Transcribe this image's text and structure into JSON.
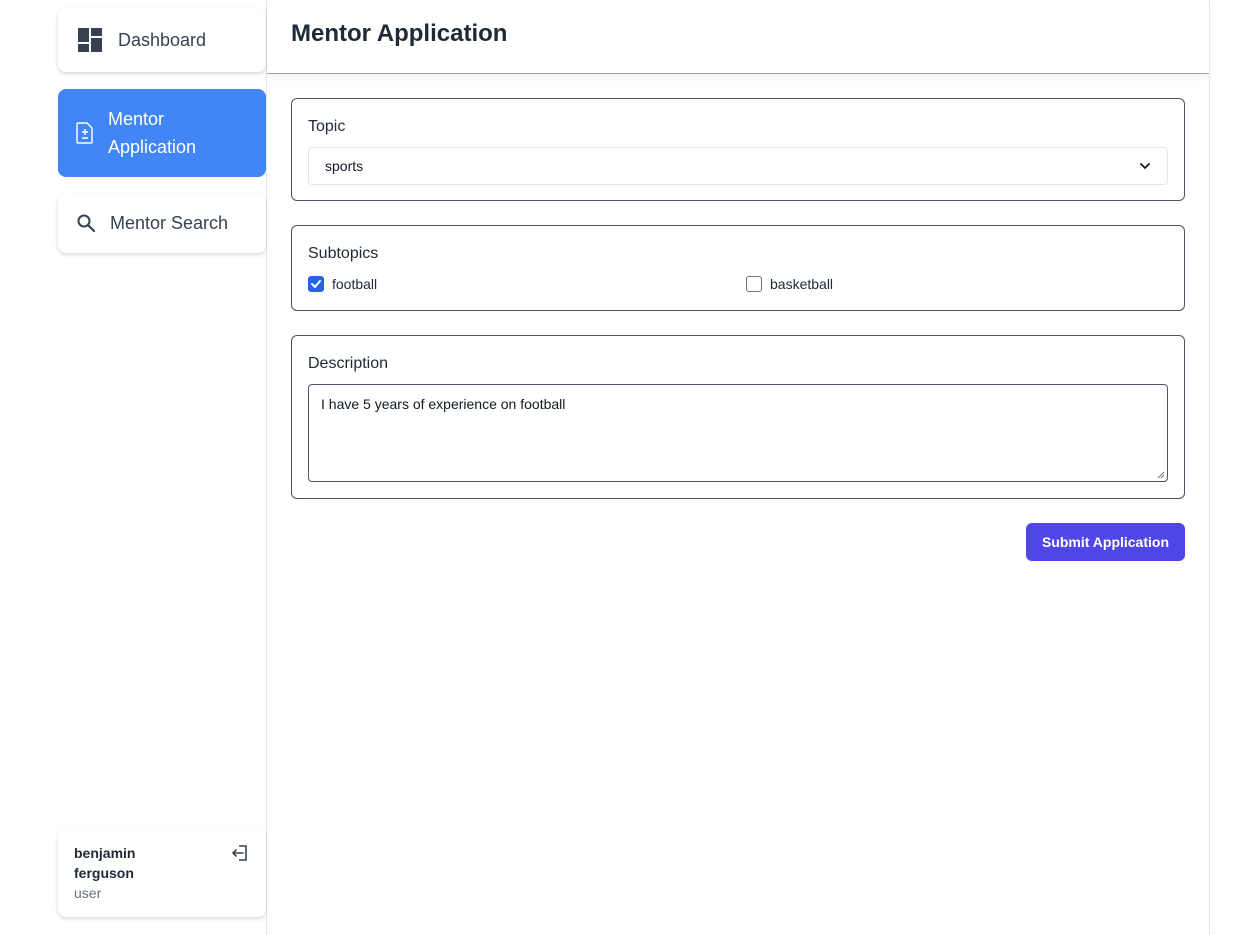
{
  "sidebar": {
    "items": [
      {
        "label": "Dashboard",
        "icon": "dashboard-icon",
        "active": false
      },
      {
        "label": "Mentor Application",
        "icon": "document-icon",
        "active": true
      },
      {
        "label": "Mentor Search",
        "icon": "search-icon",
        "active": false
      }
    ],
    "user": {
      "name": "benjamin ferguson",
      "role": "user",
      "icon": "logout-icon"
    }
  },
  "header": {
    "title": "Mentor Application"
  },
  "form": {
    "topic": {
      "label": "Topic",
      "value": "sports"
    },
    "subtopics": {
      "label": "Subtopics",
      "options": [
        {
          "label": "football",
          "checked": true
        },
        {
          "label": "basketball",
          "checked": false
        }
      ]
    },
    "description": {
      "label": "Description",
      "value": "I have 5 years of experience on football"
    },
    "submit_label": "Submit Application"
  },
  "colors": {
    "active_nav": "#4285f4",
    "submit_button": "#4f46e5",
    "checkbox_checked": "#2563eb"
  }
}
